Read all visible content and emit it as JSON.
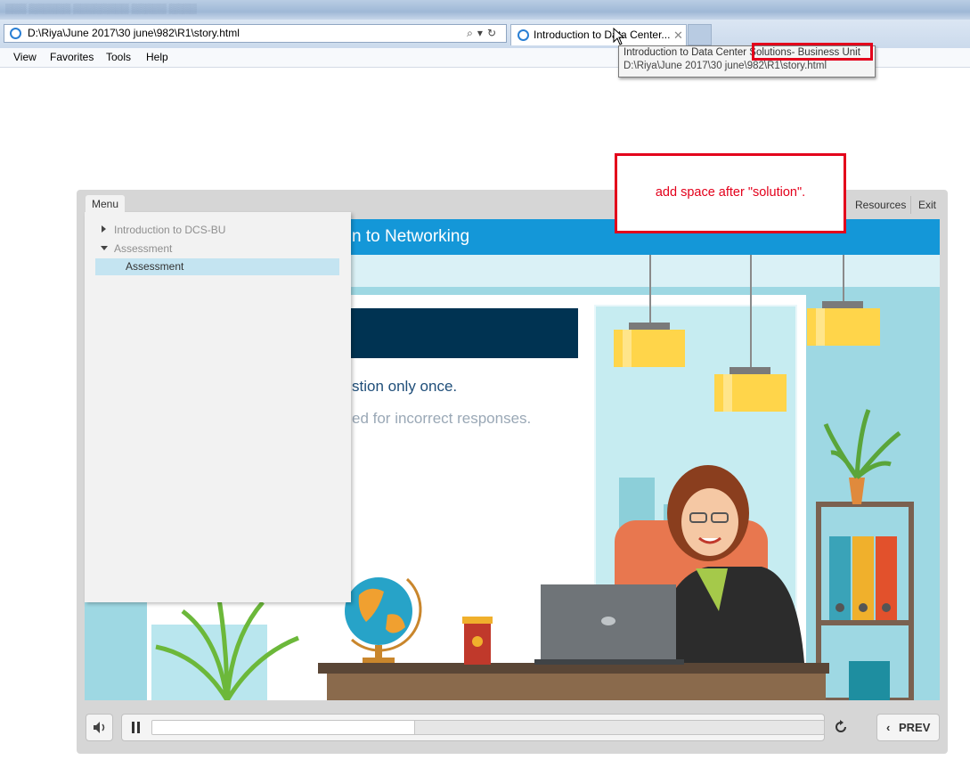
{
  "browser": {
    "address": "D:\\Riya\\June 2017\\30 june\\982\\R1\\story.html",
    "tab_title": "Introduction to Data Center...",
    "tab_close": "✕",
    "menu": [
      "View",
      "Favorites",
      "Tools",
      "Help"
    ],
    "tooltip": {
      "line1": "Introduction to Data Center Solutions- Business Unit",
      "line2": "D:\\Riya\\June 2017\\30 june\\982\\R1\\story.html"
    }
  },
  "player": {
    "menu_tab": "Menu",
    "resources": "Resources",
    "exit": "Exit",
    "menu_items": [
      {
        "label": "Introduction to DCS-BU",
        "state": "collapsed"
      },
      {
        "label": "Assessment",
        "state": "expanded"
      },
      {
        "label": "Assessment",
        "state": "selected"
      }
    ],
    "slide": {
      "title_visible": "n to Networking",
      "line1_visible": "stion only once.",
      "line2_visible": "ed for incorrect responses."
    },
    "controls": {
      "progress": 0.39,
      "prev_label": "PREV"
    }
  },
  "annotation": {
    "text": "add space after \"solution\".",
    "color": "#e3001b"
  },
  "colors": {
    "slide_header": "#1497d8",
    "card_header": "#003352",
    "slide_bg": "#9ed8e3",
    "menu_selected": "#c4e4f1"
  }
}
